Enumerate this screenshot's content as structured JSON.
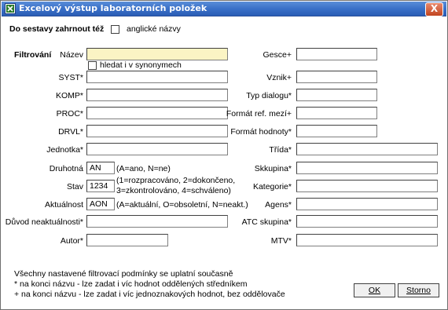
{
  "window": {
    "title": "Excelový výstup laboratorních položek",
    "close_label": "X"
  },
  "header": {
    "include_label": "Do sestavy zahrnout též",
    "english_names_label": "anglické názvy",
    "english_names_checked": false
  },
  "filter": {
    "section_label": "Filtrování",
    "nazev_label": "Název",
    "nazev_value": "",
    "synonyms_label": "hledat i v synonymech",
    "synonyms_checked": false,
    "syst_label": "SYST*",
    "komp_label": "KOMP*",
    "proc_label": "PROC*",
    "drvl_label": "DRVL*",
    "jednotka_label": "Jednotka*",
    "druhotna_label": "Druhotná",
    "druhotna_value": "AN",
    "druhotna_hint": "(A=ano, N=ne)",
    "stav_label": "Stav",
    "stav_value": "1234",
    "stav_hint1": "(1=rozpracováno, 2=dokončeno,",
    "stav_hint2": "3=zkontrolováno, 4=schváleno)",
    "aktualnost_label": "Aktuálnost",
    "aktualnost_value": "AON",
    "aktualnost_hint": "(A=aktuální, O=obsoletní, N=neakt.)",
    "duvod_label": "Důvod neaktuálnosti*",
    "autor_label": "Autor*",
    "gesce_label": "Gesce+",
    "vznik_label": "Vznik+",
    "typ_dialogu_label": "Typ dialogu*",
    "format_ref_label": "Formát ref. mezí+",
    "format_hodnoty_label": "Formát hodnoty*",
    "trida_label": "Třída*",
    "skkupina_label": "Skkupina*",
    "kategorie_label": "Kategorie*",
    "agens_label": "Agens*",
    "atc_label": "ATC skupina*",
    "mtv_label": "MTV*"
  },
  "notes": {
    "line1": "Všechny nastavené filtrovací podmínky se uplatní současně",
    "line2": "* na konci názvu - lze zadat i víc hodnot oddělených středníkem",
    "line3": "+ na konci názvu - lze zadat i víc jednoznakových hodnot, bez oddělovače"
  },
  "buttons": {
    "ok_label": "OK",
    "storno_label": "Storno"
  },
  "colors": {
    "title_bar": "#3a70c8",
    "name_field": "#fbf4c4"
  }
}
